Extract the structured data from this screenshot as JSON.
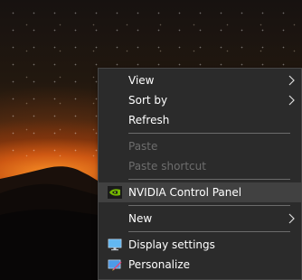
{
  "context_menu": {
    "items": [
      {
        "label": "View",
        "submenu": true,
        "enabled": true
      },
      {
        "label": "Sort by",
        "submenu": true,
        "enabled": true
      },
      {
        "label": "Refresh",
        "submenu": false,
        "enabled": true
      },
      {
        "label": "Paste",
        "submenu": false,
        "enabled": false
      },
      {
        "label": "Paste shortcut",
        "submenu": false,
        "enabled": false
      },
      {
        "label": "NVIDIA Control Panel",
        "submenu": false,
        "enabled": true,
        "icon": "nvidia-icon",
        "highlighted": true
      },
      {
        "label": "New",
        "submenu": true,
        "enabled": true
      },
      {
        "label": "Display settings",
        "submenu": false,
        "enabled": true,
        "icon": "display-settings-icon"
      },
      {
        "label": "Personalize",
        "submenu": false,
        "enabled": true,
        "icon": "personalize-icon"
      }
    ]
  },
  "colors": {
    "menu_background": "#2b2b2b",
    "menu_text": "#ffffff",
    "disabled_text": "#6d6d6d",
    "highlight": "#414141",
    "nvidia_green": "#76b900"
  }
}
